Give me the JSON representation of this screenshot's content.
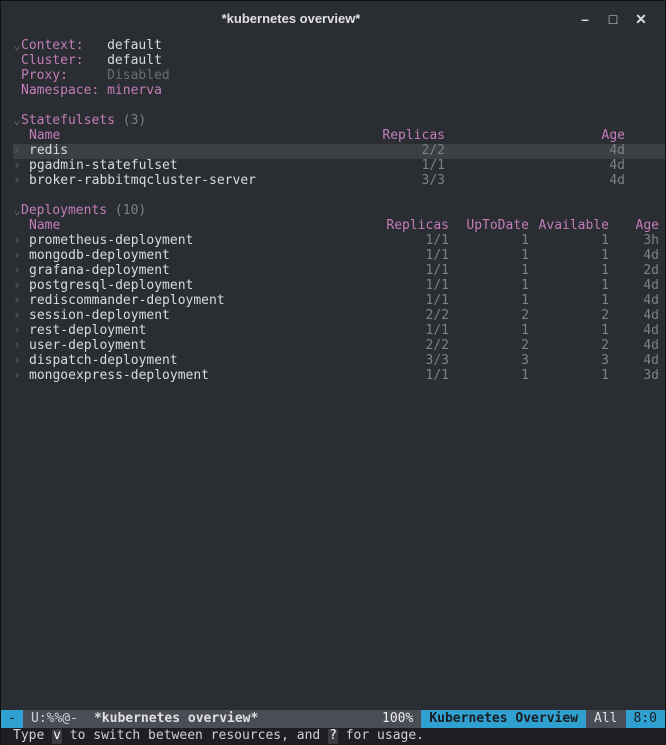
{
  "window": {
    "title": "*kubernetes overview*"
  },
  "header": {
    "context_label": "Context:  ",
    "context_value": "default",
    "cluster_label": "Cluster:  ",
    "cluster_value": "default",
    "proxy_label": "Proxy:    ",
    "proxy_value": "Disabled",
    "namespace_label": "Namespace:",
    "namespace_value": "minerva"
  },
  "statefulsets": {
    "title": "Statefulsets",
    "count": "(3)",
    "headers": {
      "name": "Name",
      "replicas": "Replicas",
      "age": "Age"
    },
    "rows": [
      {
        "name": "redis",
        "replicas": "2/2",
        "age": "4d",
        "selected": true
      },
      {
        "name": "pgadmin-statefulset",
        "replicas": "1/1",
        "age": "4d",
        "selected": false
      },
      {
        "name": "broker-rabbitmqcluster-server",
        "replicas": "3/3",
        "age": "4d",
        "selected": false
      }
    ]
  },
  "deployments": {
    "title": "Deployments",
    "count": "(10)",
    "headers": {
      "name": "Name",
      "replicas": "Replicas",
      "uptodate": "UpToDate",
      "available": "Available",
      "age": "Age"
    },
    "rows": [
      {
        "name": "prometheus-deployment",
        "replicas": "1/1",
        "uptodate": "1",
        "available": "1",
        "age": "3h"
      },
      {
        "name": "mongodb-deployment",
        "replicas": "1/1",
        "uptodate": "1",
        "available": "1",
        "age": "4d"
      },
      {
        "name": "grafana-deployment",
        "replicas": "1/1",
        "uptodate": "1",
        "available": "1",
        "age": "2d"
      },
      {
        "name": "postgresql-deployment",
        "replicas": "1/1",
        "uptodate": "1",
        "available": "1",
        "age": "4d"
      },
      {
        "name": "rediscommander-deployment",
        "replicas": "1/1",
        "uptodate": "1",
        "available": "1",
        "age": "4d"
      },
      {
        "name": "session-deployment",
        "replicas": "2/2",
        "uptodate": "2",
        "available": "2",
        "age": "4d"
      },
      {
        "name": "rest-deployment",
        "replicas": "1/1",
        "uptodate": "1",
        "available": "1",
        "age": "4d"
      },
      {
        "name": "user-deployment",
        "replicas": "2/2",
        "uptodate": "2",
        "available": "2",
        "age": "4d"
      },
      {
        "name": "dispatch-deployment",
        "replicas": "3/3",
        "uptodate": "3",
        "available": "3",
        "age": "4d"
      },
      {
        "name": "mongoexpress-deployment",
        "replicas": "1/1",
        "uptodate": "1",
        "available": "1",
        "age": "3d"
      }
    ]
  },
  "modeline": {
    "icon": "-",
    "flags": "U:%%@-",
    "buffer": "*kubernetes overview*",
    "percent": "100%",
    "mode": "Kubernetes Overview",
    "all": "All",
    "line": "8:",
    "col": "0"
  },
  "minibuffer": {
    "pre": "Type ",
    "k1": "v",
    "mid": " to switch between resources, and ",
    "k2": "?",
    "post": " for usage."
  }
}
